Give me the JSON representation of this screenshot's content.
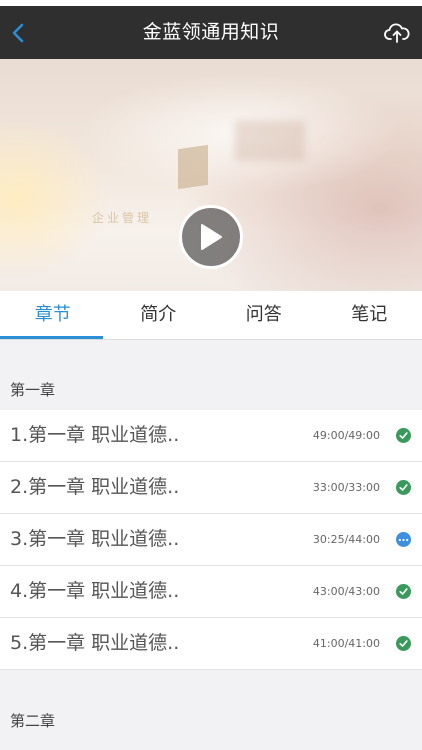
{
  "header": {
    "title": "金蓝领通用知识",
    "back_icon": "chevron-left-icon",
    "upload_icon": "cloud-upload-icon"
  },
  "video": {
    "play_icon": "play-icon",
    "overlay_text": "企业管理"
  },
  "tabs": [
    {
      "label": "章节",
      "active": true
    },
    {
      "label": "简介",
      "active": false
    },
    {
      "label": "问答",
      "active": false
    },
    {
      "label": "笔记",
      "active": false
    }
  ],
  "chapters": [
    {
      "title": "第一章",
      "items": [
        {
          "label": "1.第一章 职业道德..",
          "time": "49:00/49:00",
          "status": "completed"
        },
        {
          "label": "2.第一章 职业道德..",
          "time": "33:00/33:00",
          "status": "completed"
        },
        {
          "label": "3.第一章 职业道德..",
          "time": "30:25/44:00",
          "status": "in-progress"
        },
        {
          "label": "4.第一章 职业道德..",
          "time": "43:00/43:00",
          "status": "completed"
        },
        {
          "label": "5.第一章 职业道德..",
          "time": "41:00/41:00",
          "status": "completed"
        }
      ]
    },
    {
      "title": "第二章",
      "items": []
    }
  ],
  "colors": {
    "accent": "#2a8fd4",
    "navbar_bg": "#2f2f30",
    "completed": "#3a9a5b",
    "in_progress": "#3e8fe0"
  }
}
